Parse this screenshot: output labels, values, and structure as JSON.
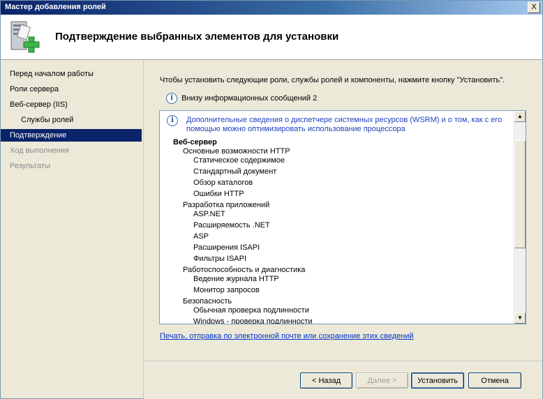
{
  "window": {
    "title": "Мастер добавления ролей",
    "close_label": "X"
  },
  "header": {
    "heading": "Подтверждение выбранных элементов для установки",
    "icon": "server-add-icon"
  },
  "sidebar": {
    "items": [
      {
        "label": "Перед началом работы",
        "state": "normal"
      },
      {
        "label": "Роли сервера",
        "state": "normal"
      },
      {
        "label": "Веб-сервер (IIS)",
        "state": "normal"
      },
      {
        "label": "Службы ролей",
        "state": "sub"
      },
      {
        "label": "Подтверждение",
        "state": "active"
      },
      {
        "label": "Ход выполнения",
        "state": "disabled"
      },
      {
        "label": "Результаты",
        "state": "disabled"
      }
    ]
  },
  "main": {
    "intro": "Чтобы установить следующие роли, службы ролей и компоненты, нажмите кнопку \"Установить\".",
    "info_count": "Внизу информационных сообщений 2",
    "notice": "Дополнительные сведения о диспетчере системных ресурсов (WSRM) и о том, как с его помощью можно оптимизировать использование процессора",
    "tree": [
      {
        "label": "Веб-сервер",
        "level": 0
      },
      {
        "label": "Основные возможности HTTP",
        "level": 1
      },
      {
        "label": "Статическое содержимое",
        "level": 2
      },
      {
        "label": "Стандартный документ",
        "level": 2
      },
      {
        "label": "Обзор каталогов",
        "level": 2
      },
      {
        "label": "Ошибки HTTP",
        "level": 2
      },
      {
        "label": "Разработка приложений",
        "level": 1
      },
      {
        "label": "ASP.NET",
        "level": 2
      },
      {
        "label": "Расширяемость .NET",
        "level": 2
      },
      {
        "label": "ASP",
        "level": 2
      },
      {
        "label": "Расширения ISAPI",
        "level": 2
      },
      {
        "label": "Фильтры ISAPI",
        "level": 2
      },
      {
        "label": "Работоспособность и диагностика",
        "level": 1
      },
      {
        "label": "Ведение журнала HTTP",
        "level": 2
      },
      {
        "label": "Монитор запросов",
        "level": 2
      },
      {
        "label": "Безопасность",
        "level": 1
      },
      {
        "label": "Обычная проверка подлинности",
        "level": 2
      },
      {
        "label": "Windows - проверка подлинности",
        "level": 2
      }
    ],
    "print_link": "Печать, отправка по электронной почте или сохранение этих сведений"
  },
  "footer": {
    "back": "< Назад",
    "next": "Далее >",
    "install": "Установить",
    "cancel": "Отмена"
  }
}
